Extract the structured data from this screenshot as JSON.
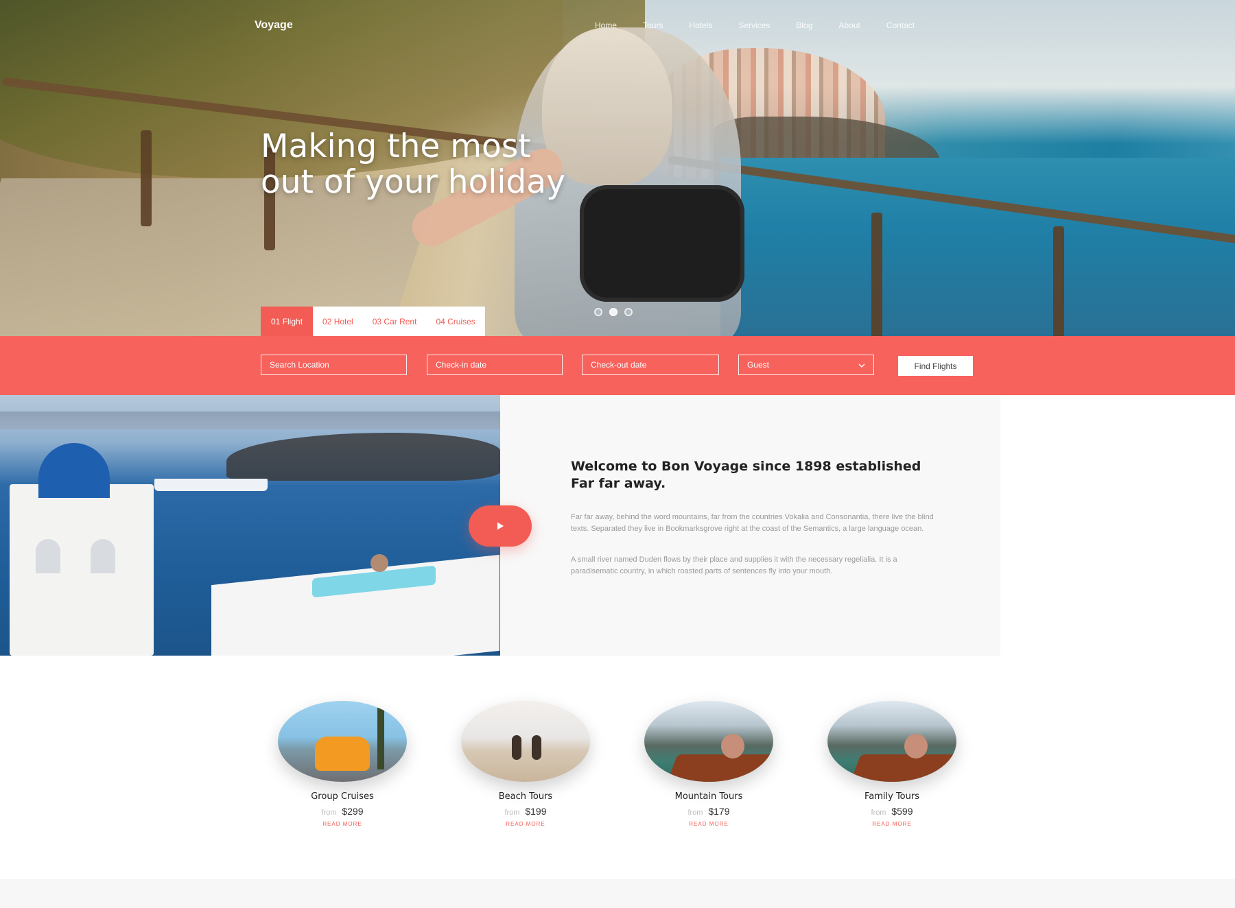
{
  "brand": "Voyage",
  "nav": {
    "links": [
      "Home",
      "Tours",
      "Hotels",
      "Services",
      "Blog",
      "About",
      "Contact"
    ]
  },
  "hero": {
    "headline_line1": "Making the most",
    "headline_line2": "out of your holiday",
    "slides": {
      "count": 3,
      "active_index": 1
    }
  },
  "booking": {
    "tabs": [
      "01 Flight",
      "02 Hotel",
      "03 Car Rent",
      "04 Cruises"
    ],
    "active_tab_index": 0,
    "fields": {
      "location": "Search Location",
      "checkin": "Check-in date",
      "checkout": "Check-out date",
      "guest": "Guest"
    },
    "button": "Find Flights"
  },
  "about": {
    "title": "Welcome to Bon Voyage since 1898 established Far far away.",
    "paragraph1": "Far far away, behind the word mountains, far from the countries Vokalia and Consonantia, there live the blind texts. Separated they live in Bookmarksgrove right at the coast of the Semantics, a large language ocean.",
    "paragraph2": "A small river named Duden flows by their place and supplies it with the necessary regelialia. It is a paradisematic country, in which roasted parts of sentences fly into your mouth."
  },
  "tours": [
    {
      "name": "Group Cruises",
      "from_label": "from",
      "price": "$299",
      "more": "READ MORE"
    },
    {
      "name": "Beach Tours",
      "from_label": "from",
      "price": "$199",
      "more": "READ MORE"
    },
    {
      "name": "Mountain Tours",
      "from_label": "from",
      "price": "$179",
      "more": "READ MORE"
    },
    {
      "name": "Family Tours",
      "from_label": "from",
      "price": "$599",
      "more": "READ MORE"
    }
  ],
  "colors": {
    "accent": "#f7625d",
    "accent_dark": "#f25c54",
    "text": "#222222",
    "muted": "#9a9a9a"
  },
  "icons": {
    "play": "play-icon",
    "dropdown": "chevron-down-icon"
  }
}
